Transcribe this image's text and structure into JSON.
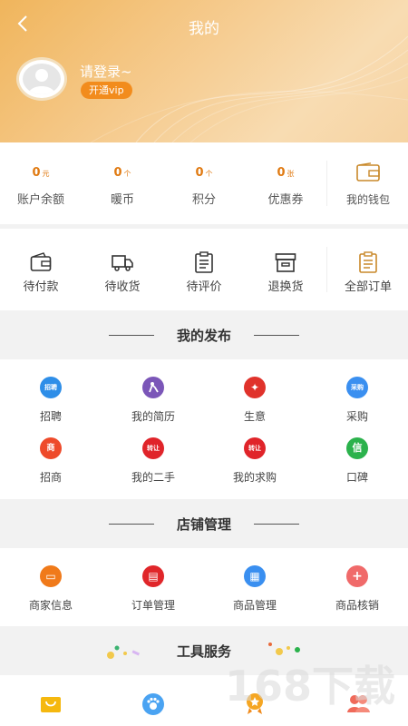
{
  "header": {
    "title": "我的",
    "login_text": "请登录~",
    "vip_label": "开通vip"
  },
  "stats": [
    {
      "value": "0",
      "unit": "元",
      "label": "账户余额"
    },
    {
      "value": "0",
      "unit": "个",
      "label": "暖币"
    },
    {
      "value": "0",
      "unit": "个",
      "label": "积分"
    },
    {
      "value": "0",
      "unit": "张",
      "label": "优惠券"
    }
  ],
  "wallet": {
    "label": "我的钱包",
    "icon": "wallet-icon"
  },
  "orders": [
    {
      "label": "待付款",
      "icon": "wallet-icon"
    },
    {
      "label": "待收货",
      "icon": "truck-icon"
    },
    {
      "label": "待评价",
      "icon": "clipboard-icon"
    },
    {
      "label": "退换货",
      "icon": "box-icon"
    },
    {
      "label": "全部订单",
      "icon": "order-list-icon"
    }
  ],
  "sections": {
    "publish": {
      "title": "我的发布",
      "items": [
        {
          "label": "招聘",
          "badge": "招聘",
          "color": "#2e8ee8"
        },
        {
          "label": "我的简历",
          "badge": "",
          "color": "#7b56b8"
        },
        {
          "label": "生意",
          "badge": "✦",
          "color": "#e0322b"
        },
        {
          "label": "采购",
          "badge": "采购",
          "color": "#3a8ff0"
        },
        {
          "label": "招商",
          "badge": "商",
          "color": "#ee4a2a"
        },
        {
          "label": "我的二手",
          "badge": "转让",
          "color": "#e0242a"
        },
        {
          "label": "我的求购",
          "badge": "转让",
          "color": "#e0242a"
        },
        {
          "label": "口碑",
          "badge": "信",
          "color": "#2bb24c"
        }
      ]
    },
    "shop": {
      "title": "店铺管理",
      "items": [
        {
          "label": "商家信息",
          "badge": "▭",
          "color": "#f07a1a"
        },
        {
          "label": "订单管理",
          "badge": "▤",
          "color": "#e0262a"
        },
        {
          "label": "商品管理",
          "badge": "▦",
          "color": "#3a8ff0"
        },
        {
          "label": "商品核销",
          "badge": "+",
          "color": "#f06a6a"
        }
      ]
    },
    "tools": {
      "title": "工具服务"
    }
  },
  "tools_icons": [
    "shopping-bag-icon",
    "footprint-icon",
    "medal-icon",
    "people-icon"
  ],
  "watermark": {
    "text": "168下载"
  },
  "colors": {
    "accent": "#e07a12",
    "vip": "#f28c1d",
    "header_start": "#f0b55c",
    "header_end": "#f8dcb2"
  }
}
